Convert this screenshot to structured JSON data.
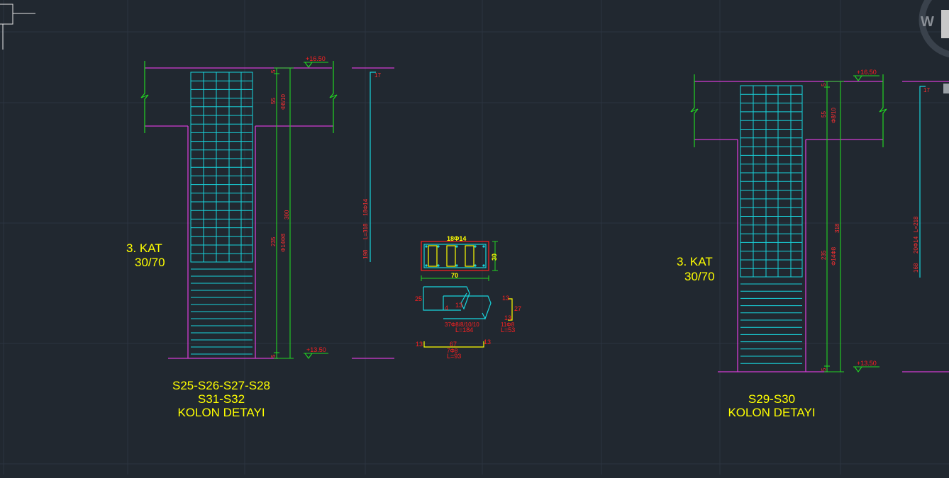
{
  "colors": {
    "background": "#212830",
    "grid": "#2c3440",
    "magenta": "#d23cd2",
    "cyan": "#18d4dc",
    "green": "#22d422",
    "red": "#ff2020",
    "yellow": "#ffff00",
    "white": "#e6e6e6"
  },
  "viewcube": {
    "label": "W"
  },
  "left_detail": {
    "level_top": "+16.50",
    "level_bottom": "+13.50",
    "floor_name": "3. KAT",
    "section": "30/70",
    "title_line1": "S25-S26-S27-S28",
    "title_line2": "S31-S32",
    "title_line3": "KOLON DETAYI",
    "top_small": "17",
    "dim_total": "300",
    "dim_beam": "55",
    "dim_stirrup_top": "Φ8/10",
    "dim_mid": "235",
    "dim_stirrup_mid": "Φ14Φ8",
    "dim_end_top": "5",
    "dim_end_bottom": "5",
    "bar_text_a": "18Φ14",
    "bar_text_b": "L=318",
    "bar_text_c": "198"
  },
  "right_detail": {
    "level_top": "+16.50",
    "level_bottom": "+13.50",
    "floor_name": "3. KAT",
    "section": "30/70",
    "title_line1": "S29-S30",
    "title_line2": "KOLON DETAYI",
    "top_small": "17",
    "dim_total": "318",
    "dim_beam": "55",
    "dim_stirrup_top": "Φ8/10",
    "dim_mid": "235",
    "dim_stirrup_mid": "Φ14Φ8",
    "dim_end_top": "5",
    "dim_end_bottom": "5",
    "bar_text_a": "20Φ14",
    "bar_text_b": "L=218",
    "bar_text_c": "168"
  },
  "cross_section": {
    "rebar_label": "18Φ14",
    "height_dim": "30",
    "width_dim": "70",
    "stirrup_dim_a": "25",
    "stirrup_dim_b": "4",
    "stirrup_dim_c": "13",
    "stirrup_label": "37Φ8/8/10/10",
    "stirrup_length": "L=184",
    "tie_dim_a": "13",
    "tie_dim_b": "27",
    "tie_dim_c": "13",
    "tie_label": "11Φ8",
    "tie_length": "L=53",
    "bar_dim_left": "13",
    "bar_dim_mid": "67",
    "bar_dim_right": "13",
    "bar_label": "7Φ8",
    "bar_length": "L=93"
  }
}
